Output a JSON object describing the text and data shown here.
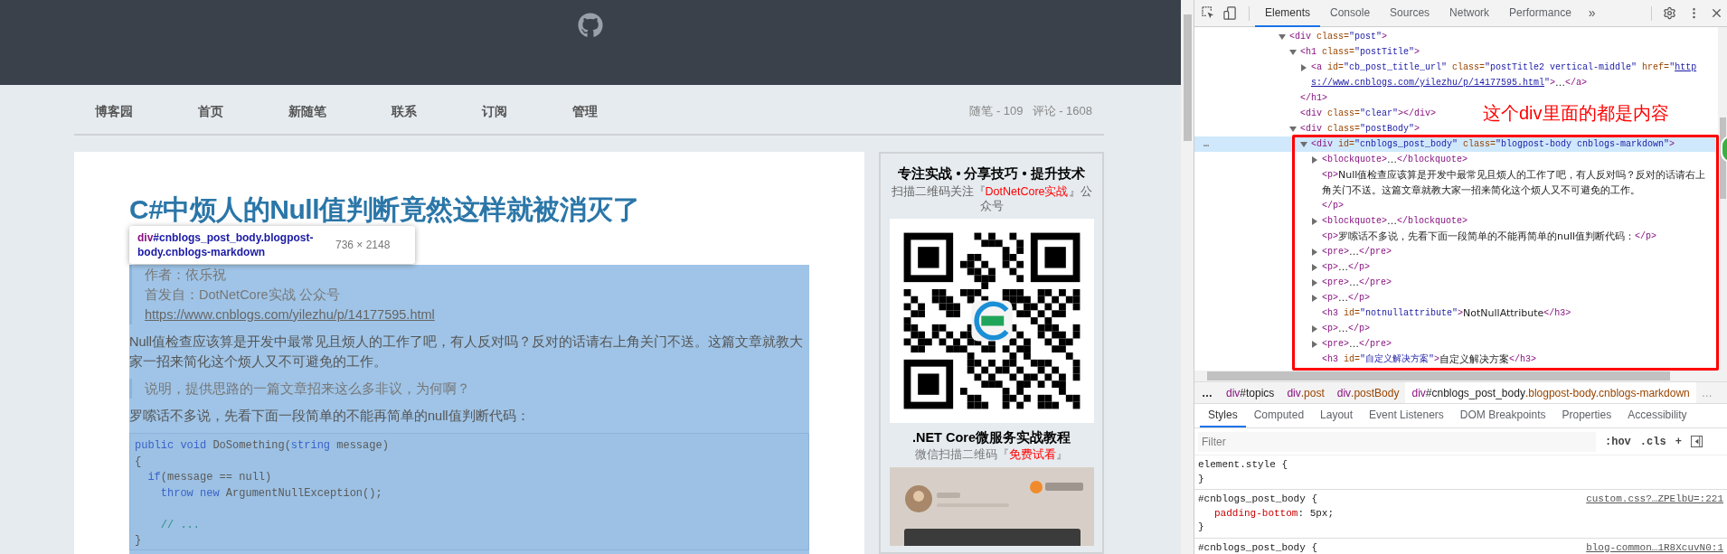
{
  "page": {
    "nav": [
      "博客园",
      "首页",
      "新随笔",
      "联系",
      "订阅",
      "管理"
    ],
    "stats": [
      "随笔 - 109",
      "评论 - 1608"
    ],
    "post": {
      "title": "C#中烦人的Null值判断竟然这样就被消灭了",
      "inspect_tooltip": {
        "tag": "div",
        "selector": "#cnblogs_post_body.blogpost-body.cnblogs-markdown",
        "size": "736 × 2148"
      },
      "highlighted": true,
      "blocks": [
        {
          "kind": "quote",
          "lines": [
            {
              "kind": "text",
              "text": "作者：依乐祝"
            },
            {
              "kind": "text",
              "text": "首发自：DotNetCore实战 公众号"
            },
            {
              "kind": "link",
              "text": "https://www.cnblogs.com/yilezhu/p/14177595.html"
            }
          ]
        },
        {
          "kind": "paragraph",
          "text": "Null值检查应该算是开发中最常见且烦人的工作了吧，有人反对吗？反对的话请右上角关门不送。这篇文章就教大家一招来简化这个烦人又不可避免的工作。"
        },
        {
          "kind": "quote",
          "lines": [
            {
              "kind": "text",
              "text": "说明，提供思路的一篇文章招来这么多非议，为何啊？"
            }
          ]
        },
        {
          "kind": "paragraph",
          "text": "罗嗦话不多说，先看下面一段简单的不能再简单的null值判断代码："
        },
        {
          "kind": "code",
          "lines": [
            {
              "kind": "code",
              "tokens": [
                {
                  "kind": "keyword",
                  "text": "public void"
                },
                {
                  "kind": "plain",
                  "text": " DoSomething("
                },
                {
                  "kind": "keyword",
                  "text": "string"
                },
                {
                  "kind": "plain",
                  "text": " message)"
                }
              ]
            },
            {
              "kind": "code",
              "tokens": [
                {
                  "kind": "plain",
                  "text": "{"
                }
              ]
            },
            {
              "kind": "code",
              "tokens": [
                {
                  "kind": "keyword",
                  "text": "  if"
                },
                {
                  "kind": "plain",
                  "text": "(message == null)"
                }
              ]
            },
            {
              "kind": "code",
              "tokens": [
                {
                  "kind": "keyword",
                  "text": "    throw new"
                },
                {
                  "kind": "plain",
                  "text": " ArgumentNullException();"
                }
              ]
            },
            {
              "kind": "blank"
            },
            {
              "kind": "code",
              "tokens": [
                {
                  "kind": "comment",
                  "text": "    // ..."
                }
              ]
            },
            {
              "kind": "code",
              "tokens": [
                {
                  "kind": "plain",
                  "text": "}"
                }
              ]
            }
          ]
        }
      ]
    },
    "sidebar": {
      "heading": "专注实战 • 分享技巧 • 提升技术",
      "subscribe": [
        {
          "kind": "plain",
          "text": "扫描二维码关注『"
        },
        {
          "kind": "accent",
          "text": "DotNetCore实战"
        },
        {
          "kind": "plain",
          "text": "』公众号"
        }
      ],
      "course_title": ".NET Core微服务实战教程",
      "course_note": [
        {
          "kind": "plain",
          "text": "微信扫描二维码『"
        },
        {
          "kind": "accent",
          "text": "免费试看"
        },
        {
          "kind": "plain",
          "text": "』"
        }
      ]
    }
  },
  "devtools": {
    "tabs": [
      {
        "label": "Elements",
        "selected": true
      },
      {
        "label": "Console",
        "selected": false
      },
      {
        "label": "Sources",
        "selected": false
      },
      {
        "label": "Network",
        "selected": false
      },
      {
        "label": "Performance",
        "selected": false
      }
    ],
    "more_tabs": "»",
    "tree": [
      {
        "kind": "branch",
        "expanded": true,
        "selected": false,
        "open": [
          {
            "kind": "tag",
            "text": "<div"
          },
          {
            "kind": "attr",
            "text": " class="
          },
          {
            "kind": "value",
            "text": "\"post\""
          },
          {
            "kind": "tag",
            "text": ">"
          }
        ],
        "children": [
          {
            "kind": "branch",
            "expanded": true,
            "selected": false,
            "open": [
              {
                "kind": "tag",
                "text": "<h1"
              },
              {
                "kind": "attr",
                "text": " class="
              },
              {
                "kind": "value",
                "text": "\"postTitle\""
              },
              {
                "kind": "tag",
                "text": ">"
              }
            ],
            "close": [
              {
                "kind": "tag",
                "text": "</h1>"
              }
            ],
            "children": [
              {
                "kind": "branch",
                "expanded": false,
                "selected": false,
                "open": [
                  {
                    "kind": "tag",
                    "text": "<a"
                  },
                  {
                    "kind": "attr",
                    "text": " id="
                  },
                  {
                    "kind": "value",
                    "text": "\"cb_post_title_url\""
                  },
                  {
                    "kind": "attr",
                    "text": " class="
                  },
                  {
                    "kind": "value",
                    "text": "\"postTitle2 vertical-middle\""
                  },
                  {
                    "kind": "attr",
                    "text": " href="
                  },
                  {
                    "kind": "value",
                    "text": "\""
                  },
                  {
                    "kind": "link",
                    "text": "https://www.cnblogs.com/yilezhu/p/14177595.html"
                  },
                  {
                    "kind": "value",
                    "text": "\""
                  },
                  {
                    "kind": "tag",
                    "text": ">"
                  },
                  {
                    "kind": "text",
                    "text": "…"
                  },
                  {
                    "kind": "tag",
                    "text": "</a>"
                  }
                ]
              }
            ]
          },
          {
            "kind": "leaf",
            "selected": false,
            "open": [
              {
                "kind": "tag",
                "text": "<div"
              },
              {
                "kind": "attr",
                "text": " class="
              },
              {
                "kind": "value",
                "text": "\"clear\""
              },
              {
                "kind": "tag",
                "text": "></div>"
              }
            ]
          },
          {
            "kind": "branch",
            "expanded": true,
            "selected": false,
            "open": [
              {
                "kind": "tag",
                "text": "<div"
              },
              {
                "kind": "attr",
                "text": " class="
              },
              {
                "kind": "value",
                "text": "\"postBody\""
              },
              {
                "kind": "tag",
                "text": ">"
              }
            ],
            "children": [
              {
                "kind": "branch",
                "expanded": true,
                "selected": true,
                "gutter": "…",
                "open": [
                  {
                    "kind": "tag",
                    "text": "<div"
                  },
                  {
                    "kind": "attr",
                    "text": " id="
                  },
                  {
                    "kind": "value",
                    "text": "\"cnblogs_post_body\""
                  },
                  {
                    "kind": "attr",
                    "text": " class="
                  },
                  {
                    "kind": "value",
                    "text": "\"blogpost-body cnblogs-markdown\""
                  },
                  {
                    "kind": "tag",
                    "text": ">"
                  }
                ],
                "children": [
                  {
                    "kind": "branch",
                    "expanded": false,
                    "selected": false,
                    "open": [
                      {
                        "kind": "tag",
                        "text": "<blockquote>"
                      },
                      {
                        "kind": "text",
                        "text": "…"
                      },
                      {
                        "kind": "tag",
                        "text": "</blockquote>"
                      }
                    ]
                  },
                  {
                    "kind": "leaf",
                    "selected": false,
                    "open": [
                      {
                        "kind": "tag",
                        "text": "<p>"
                      },
                      {
                        "kind": "text",
                        "text": "Null值检查应该算是开发中最常见且烦人的工作了吧，有人反对吗？反对的话请右上角关门不送。这篇文章就教大家一招来简化这个烦人又不可避免的工作。"
                      }
                    ],
                    "close": [
                      {
                        "kind": "tag",
                        "text": "</p>"
                      }
                    ]
                  },
                  {
                    "kind": "branch",
                    "expanded": false,
                    "selected": false,
                    "open": [
                      {
                        "kind": "tag",
                        "text": "<blockquote>"
                      },
                      {
                        "kind": "text",
                        "text": "…"
                      },
                      {
                        "kind": "tag",
                        "text": "</blockquote>"
                      }
                    ]
                  },
                  {
                    "kind": "leaf",
                    "selected": false,
                    "open": [
                      {
                        "kind": "tag",
                        "text": "<p>"
                      },
                      {
                        "kind": "text",
                        "text": "罗嗦话不多说，先看下面一段简单的不能再简单的null值判断代码："
                      },
                      {
                        "kind": "tag",
                        "text": "</p>"
                      }
                    ]
                  },
                  {
                    "kind": "branch",
                    "expanded": false,
                    "selected": false,
                    "open": [
                      {
                        "kind": "tag",
                        "text": "<pre>"
                      },
                      {
                        "kind": "text",
                        "text": "…"
                      },
                      {
                        "kind": "tag",
                        "text": "</pre>"
                      }
                    ]
                  },
                  {
                    "kind": "branch",
                    "expanded": false,
                    "selected": false,
                    "open": [
                      {
                        "kind": "tag",
                        "text": "<p>"
                      },
                      {
                        "kind": "text",
                        "text": "…"
                      },
                      {
                        "kind": "tag",
                        "text": "</p>"
                      }
                    ]
                  },
                  {
                    "kind": "branch",
                    "expanded": false,
                    "selected": false,
                    "open": [
                      {
                        "kind": "tag",
                        "text": "<pre>"
                      },
                      {
                        "kind": "text",
                        "text": "…"
                      },
                      {
                        "kind": "tag",
                        "text": "</pre>"
                      }
                    ]
                  },
                  {
                    "kind": "branch",
                    "expanded": false,
                    "selected": false,
                    "open": [
                      {
                        "kind": "tag",
                        "text": "<p>"
                      },
                      {
                        "kind": "text",
                        "text": "…"
                      },
                      {
                        "kind": "tag",
                        "text": "</p>"
                      }
                    ]
                  },
                  {
                    "kind": "leaf",
                    "selected": false,
                    "open": [
                      {
                        "kind": "tag",
                        "text": "<h3"
                      },
                      {
                        "kind": "attr",
                        "text": " id="
                      },
                      {
                        "kind": "value",
                        "text": "\"notnullattribute\""
                      },
                      {
                        "kind": "tag",
                        "text": ">"
                      },
                      {
                        "kind": "text",
                        "text": "NotNullAttribute"
                      },
                      {
                        "kind": "tag",
                        "text": "</h3>"
                      }
                    ]
                  },
                  {
                    "kind": "branch",
                    "expanded": false,
                    "selected": false,
                    "open": [
                      {
                        "kind": "tag",
                        "text": "<p>"
                      },
                      {
                        "kind": "text",
                        "text": "…"
                      },
                      {
                        "kind": "tag",
                        "text": "</p>"
                      }
                    ]
                  },
                  {
                    "kind": "branch",
                    "expanded": false,
                    "selected": false,
                    "open": [
                      {
                        "kind": "tag",
                        "text": "<pre>"
                      },
                      {
                        "kind": "text",
                        "text": "…"
                      },
                      {
                        "kind": "tag",
                        "text": "</pre>"
                      }
                    ]
                  },
                  {
                    "kind": "leaf",
                    "selected": false,
                    "open": [
                      {
                        "kind": "tag",
                        "text": "<h3"
                      },
                      {
                        "kind": "attr",
                        "text": " id="
                      },
                      {
                        "kind": "value",
                        "text": "\"自定义解决方案\""
                      },
                      {
                        "kind": "tag",
                        "text": ">"
                      },
                      {
                        "kind": "text",
                        "text": "自定义解决方案"
                      },
                      {
                        "kind": "tag",
                        "text": "</h3>"
                      }
                    ]
                  }
                ]
              }
            ]
          }
        ]
      }
    ],
    "annotation": {
      "text": "这个div里面的都是内容"
    },
    "breadcrumb_lead": "…",
    "breadcrumbs": [
      {
        "selected": false,
        "parts": [
          {
            "kind": "tag",
            "text": "div"
          },
          {
            "kind": "id",
            "text": "#topics"
          }
        ]
      },
      {
        "selected": false,
        "parts": [
          {
            "kind": "tag",
            "text": "div"
          },
          {
            "kind": "class",
            "text": ".post"
          }
        ]
      },
      {
        "selected": false,
        "parts": [
          {
            "kind": "tag",
            "text": "div"
          },
          {
            "kind": "class",
            "text": ".postBody"
          }
        ]
      },
      {
        "selected": true,
        "parts": [
          {
            "kind": "tag",
            "text": "div"
          },
          {
            "kind": "id",
            "text": "#cnblogs_post_body"
          },
          {
            "kind": "class",
            "text": ".blogpost-body.cnblogs-markdown"
          }
        ]
      }
    ],
    "breadcrumb_tail": "…",
    "pane_tabs": [
      {
        "label": "Styles",
        "selected": true
      },
      {
        "label": "Computed",
        "selected": false
      },
      {
        "label": "Layout",
        "selected": false
      },
      {
        "label": "Event Listeners",
        "selected": false
      },
      {
        "label": "DOM Breakpoints",
        "selected": false
      },
      {
        "label": "Properties",
        "selected": false
      },
      {
        "label": "Accessibility",
        "selected": false
      }
    ],
    "filter": {
      "placeholder": "Filter"
    },
    "filter_buttons": [
      ":hov",
      ".cls",
      "+"
    ],
    "rules": [
      {
        "selector": "element.style {",
        "end": "}"
      },
      {
        "selector": "#cnblogs_post_body {",
        "source": "custom.css?…ZPElbU=:221",
        "declarations": [
          {
            "property": "padding-bottom",
            "colon": ":",
            "value": "5px;"
          }
        ],
        "end": "}"
      },
      {
        "selector": "#cnblogs_post_body {",
        "source": "blog-common…1R8XcuvN0:1"
      }
    ]
  }
}
